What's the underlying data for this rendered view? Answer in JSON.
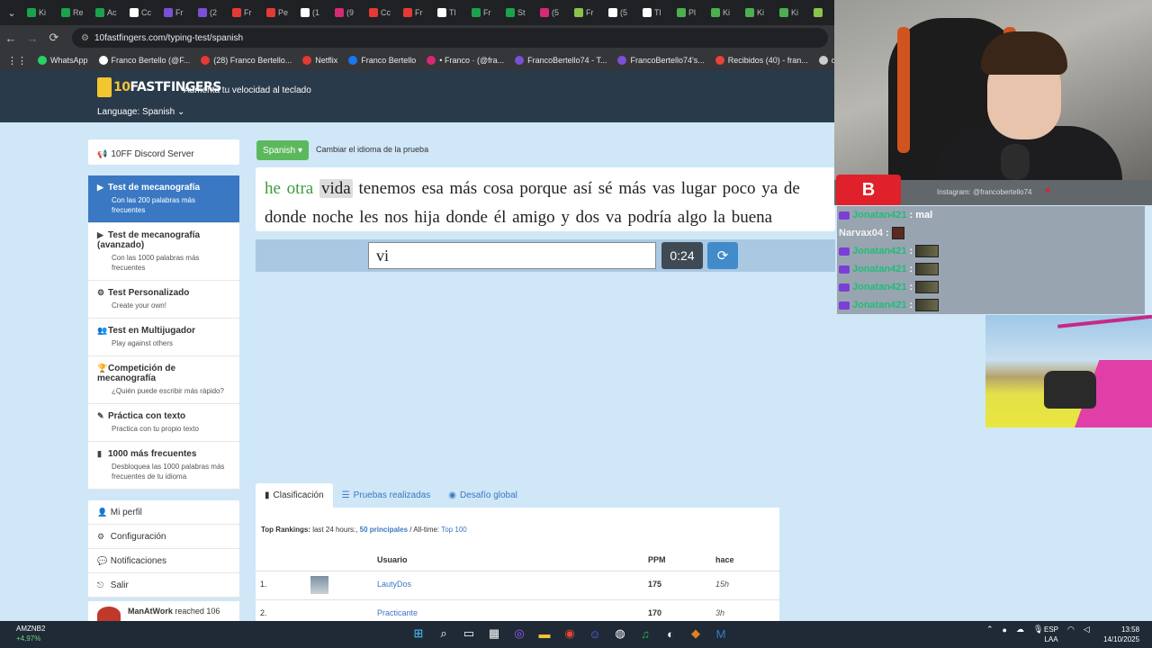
{
  "browser": {
    "tabs": [
      {
        "label": "Ki",
        "color": "#1aa34a"
      },
      {
        "label": "Re",
        "color": "#1aa34a"
      },
      {
        "label": "Ac",
        "color": "#1aa34a"
      },
      {
        "label": "Cc",
        "color": "#ffffff"
      },
      {
        "label": "Fr",
        "color": "#7b4fd6"
      },
      {
        "label": "(2",
        "color": "#7b4fd6"
      },
      {
        "label": "Fr",
        "color": "#e53935"
      },
      {
        "label": "Pe",
        "color": "#e53935"
      },
      {
        "label": "(1",
        "color": "#ffffff"
      },
      {
        "label": "(9",
        "color": "#d62976"
      },
      {
        "label": "Cc",
        "color": "#e53935"
      },
      {
        "label": "Fr",
        "color": "#e53935"
      },
      {
        "label": "Tl",
        "color": "#ffffff"
      },
      {
        "label": "Fr",
        "color": "#1aa34a"
      },
      {
        "label": "St",
        "color": "#1aa34a"
      },
      {
        "label": "(5",
        "color": "#d62976"
      },
      {
        "label": "Fr",
        "color": "#8bc34a"
      },
      {
        "label": "(5",
        "color": "#ffffff"
      },
      {
        "label": "Tl",
        "color": "#ffffff"
      },
      {
        "label": "Pl",
        "color": "#4caf50"
      },
      {
        "label": "Ki",
        "color": "#4caf50"
      },
      {
        "label": "Ki",
        "color": "#4caf50"
      },
      {
        "label": "Ki",
        "color": "#4caf50"
      },
      {
        "label": "",
        "color": "#8bc34a"
      }
    ],
    "url": "10fastfingers.com/typing-test/spanish",
    "bookmarks": [
      {
        "label": "WhatsApp",
        "color": "#25d366"
      },
      {
        "label": "Franco Bertello (@F...",
        "color": "#ffffff"
      },
      {
        "label": "(28) Franco Bertello...",
        "color": "#e53935"
      },
      {
        "label": "Netflix",
        "color": "#e53935"
      },
      {
        "label": "Franco Bertello",
        "color": "#1877f2"
      },
      {
        "label": "• Franco · (@fra...",
        "color": "#d62976"
      },
      {
        "label": "FrancoBertello74 - T...",
        "color": "#7b4fd6"
      },
      {
        "label": "FrancoBertello74's...",
        "color": "#7b4fd6"
      },
      {
        "label": "Recibidos (40) - fran...",
        "color": "#ea4335"
      },
      {
        "label": "outlook",
        "color": "#cccccc"
      },
      {
        "label": "Aler",
        "color": "#16a085"
      }
    ]
  },
  "site": {
    "logo_ten": "10",
    "logo_text": "FASTFINGERS",
    "tagline": "Aumenta tu velocidad al teclado",
    "language": "Language: Spanish"
  },
  "sidebar": {
    "discord": "10FF Discord Server",
    "items": [
      {
        "title": "Test de mecanografía",
        "sub": "Con las 200 palabras más frecuentes",
        "icon": "▶"
      },
      {
        "title": "Test de mecanografía (avanzado)",
        "sub": "Con las 1000 palabras más frecuentes",
        "icon": "▶"
      },
      {
        "title": "Test Personalizado",
        "sub": "Create your own!",
        "icon": "⚙"
      },
      {
        "title": "Test en Multijugador",
        "sub": "Play against others",
        "icon": "👥"
      },
      {
        "title": "Competición de mecanografía",
        "sub": "¿Quién puede escribir más rápido?",
        "icon": "🏆"
      },
      {
        "title": "Práctica con texto",
        "sub": "Practica con tu propio texto",
        "icon": "✎"
      },
      {
        "title": "1000 más frecuentes",
        "sub": "Desbloquea las 1000 palabras más frecuentes de tu idioma",
        "icon": "▮"
      }
    ],
    "links": [
      "Mi perfil",
      "Configuración",
      "Notificaciones",
      "Salir"
    ],
    "notification_user": "ManAtWork",
    "notification_text": " reached 106"
  },
  "test": {
    "lang_button": "Spanish ▾",
    "lang_hint": "Cambiar el idioma de la prueba",
    "line1_correct": "he otra",
    "line1_current": "vida",
    "line1_rest": "tenemos esa más cosa porque así sé más vas lugar poco ya de",
    "line2": "donde noche les nos hija donde él amigo y dos va podría algo la buena",
    "input_value": "vi",
    "timer": "0:24",
    "reload_icon": "⟳"
  },
  "rankings": {
    "tabs": [
      "Clasificación",
      "Pruebas realizadas",
      "Desafío global"
    ],
    "header_bold": "Top Rankings:",
    "header_part1": " last 24 hours:, ",
    "header_link1": "50 principales",
    "header_part2": " / All-time: ",
    "header_link2": "Top 100",
    "col_user": "Usuario",
    "col_ppm": "PPM",
    "col_when": "hace",
    "rows": [
      {
        "rank": "1.",
        "user": "LautyDos",
        "ppm": "175",
        "when": "15h"
      },
      {
        "rank": "2.",
        "user": "Practicante",
        "ppm": "170",
        "when": "3h"
      }
    ]
  },
  "overlay": {
    "instagram": "Instagram: @francobertello74",
    "badge": "B",
    "chat": [
      {
        "user": "Jonatan421",
        "msg": ": mal",
        "type": "text"
      },
      {
        "user": "Narvax04",
        "msg": ":",
        "type": "emote2"
      },
      {
        "user": "Jonatan421",
        "msg": ":",
        "type": "emote"
      },
      {
        "user": "Jonatan421",
        "msg": ":",
        "type": "emote"
      },
      {
        "user": "Jonatan421",
        "msg": ":",
        "type": "emote"
      },
      {
        "user": "Jonatan421",
        "msg": ":",
        "type": "emote"
      }
    ]
  },
  "taskbar": {
    "stock_name": "AMZNB2",
    "stock_change": "+4,97%",
    "lang_top": "ESP",
    "lang_bottom": "LAA",
    "time": "13:58",
    "date": "14/10/2025",
    "apps": [
      {
        "name": "windows-start-icon",
        "glyph": "⊞",
        "color": "#4cc2ff"
      },
      {
        "name": "search-icon",
        "glyph": "⌕",
        "color": "#ffffff"
      },
      {
        "name": "task-view-icon",
        "glyph": "▭",
        "color": "#ffffff"
      },
      {
        "name": "store-icon",
        "glyph": "▦",
        "color": "#ffffff"
      },
      {
        "name": "app-circle-icon",
        "glyph": "◎",
        "color": "#9b59ff"
      },
      {
        "name": "folder-icon",
        "glyph": "▬",
        "color": "#f2c531"
      },
      {
        "name": "chrome-icon",
        "glyph": "◉",
        "color": "#ea4335"
      },
      {
        "name": "discord-icon",
        "glyph": "☺",
        "color": "#5865f2"
      },
      {
        "name": "obs-icon",
        "glyph": "◍",
        "color": "#ffffff"
      },
      {
        "name": "spotify-icon",
        "glyph": "♫",
        "color": "#1db954"
      },
      {
        "name": "steam-icon",
        "glyph": "◐",
        "color": "#ffffff"
      },
      {
        "name": "game-icon",
        "glyph": "◆",
        "color": "#e67e22"
      },
      {
        "name": "app-m-icon",
        "glyph": "M",
        "color": "#3a78c3"
      }
    ]
  }
}
